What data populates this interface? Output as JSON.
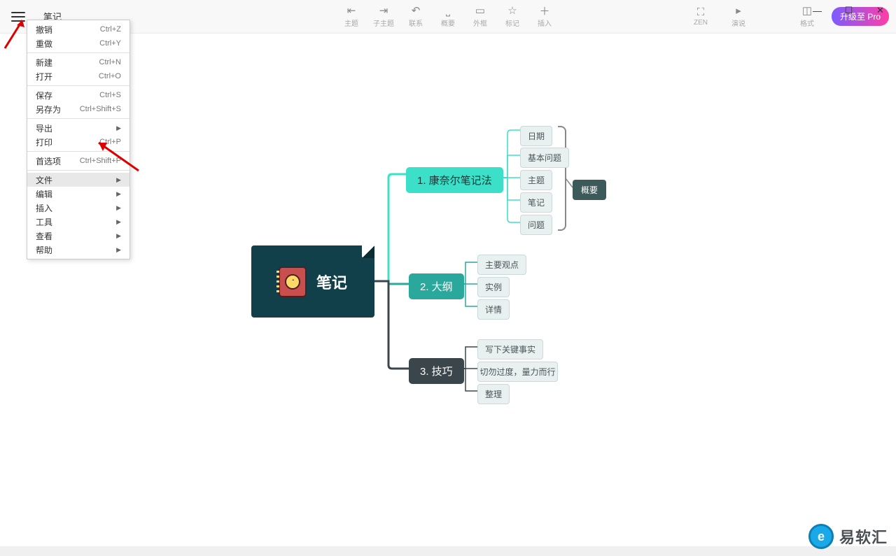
{
  "window": {
    "tab_title": "笔记"
  },
  "toolbar": {
    "center": [
      {
        "label": "主题"
      },
      {
        "label": "子主题"
      },
      {
        "label": "联系"
      },
      {
        "label": "概要"
      },
      {
        "label": "外框"
      },
      {
        "label": "标记"
      },
      {
        "label": "插入"
      }
    ],
    "right": [
      {
        "label": "ZEN"
      },
      {
        "label": "演说"
      },
      {
        "label": "格式"
      }
    ],
    "upgrade": "升级至 Pro"
  },
  "menu": {
    "groups": [
      [
        {
          "label": "撤销",
          "shortcut": "Ctrl+Z"
        },
        {
          "label": "重做",
          "shortcut": "Ctrl+Y"
        }
      ],
      [
        {
          "label": "新建",
          "shortcut": "Ctrl+N"
        },
        {
          "label": "打开",
          "shortcut": "Ctrl+O"
        }
      ],
      [
        {
          "label": "保存",
          "shortcut": "Ctrl+S"
        },
        {
          "label": "另存为",
          "shortcut": "Ctrl+Shift+S"
        }
      ],
      [
        {
          "label": "导出",
          "submenu": true
        },
        {
          "label": "打印",
          "shortcut": "Ctrl+P"
        }
      ],
      [
        {
          "label": "首选项",
          "shortcut": "Ctrl+Shift+P"
        }
      ],
      [
        {
          "label": "文件",
          "submenu": true,
          "highlight": true
        },
        {
          "label": "编辑",
          "submenu": true
        },
        {
          "label": "插入",
          "submenu": true
        },
        {
          "label": "工具",
          "submenu": true
        },
        {
          "label": "查看",
          "submenu": true
        },
        {
          "label": "帮助",
          "submenu": true
        }
      ]
    ]
  },
  "mindmap": {
    "root": "笔记",
    "branches": [
      {
        "label": "1. 康奈尔笔记法",
        "leaves": [
          "日期",
          "基本问题",
          "主题",
          "笔记",
          "问题"
        ],
        "summary": "概要"
      },
      {
        "label": "2. 大纲",
        "leaves": [
          "主要观点",
          "实例",
          "详情"
        ]
      },
      {
        "label": "3. 技巧",
        "leaves": [
          "写下关键事实",
          "切勿过度，量力而行",
          "整理"
        ]
      }
    ]
  },
  "watermark": {
    "text": "易软汇"
  }
}
